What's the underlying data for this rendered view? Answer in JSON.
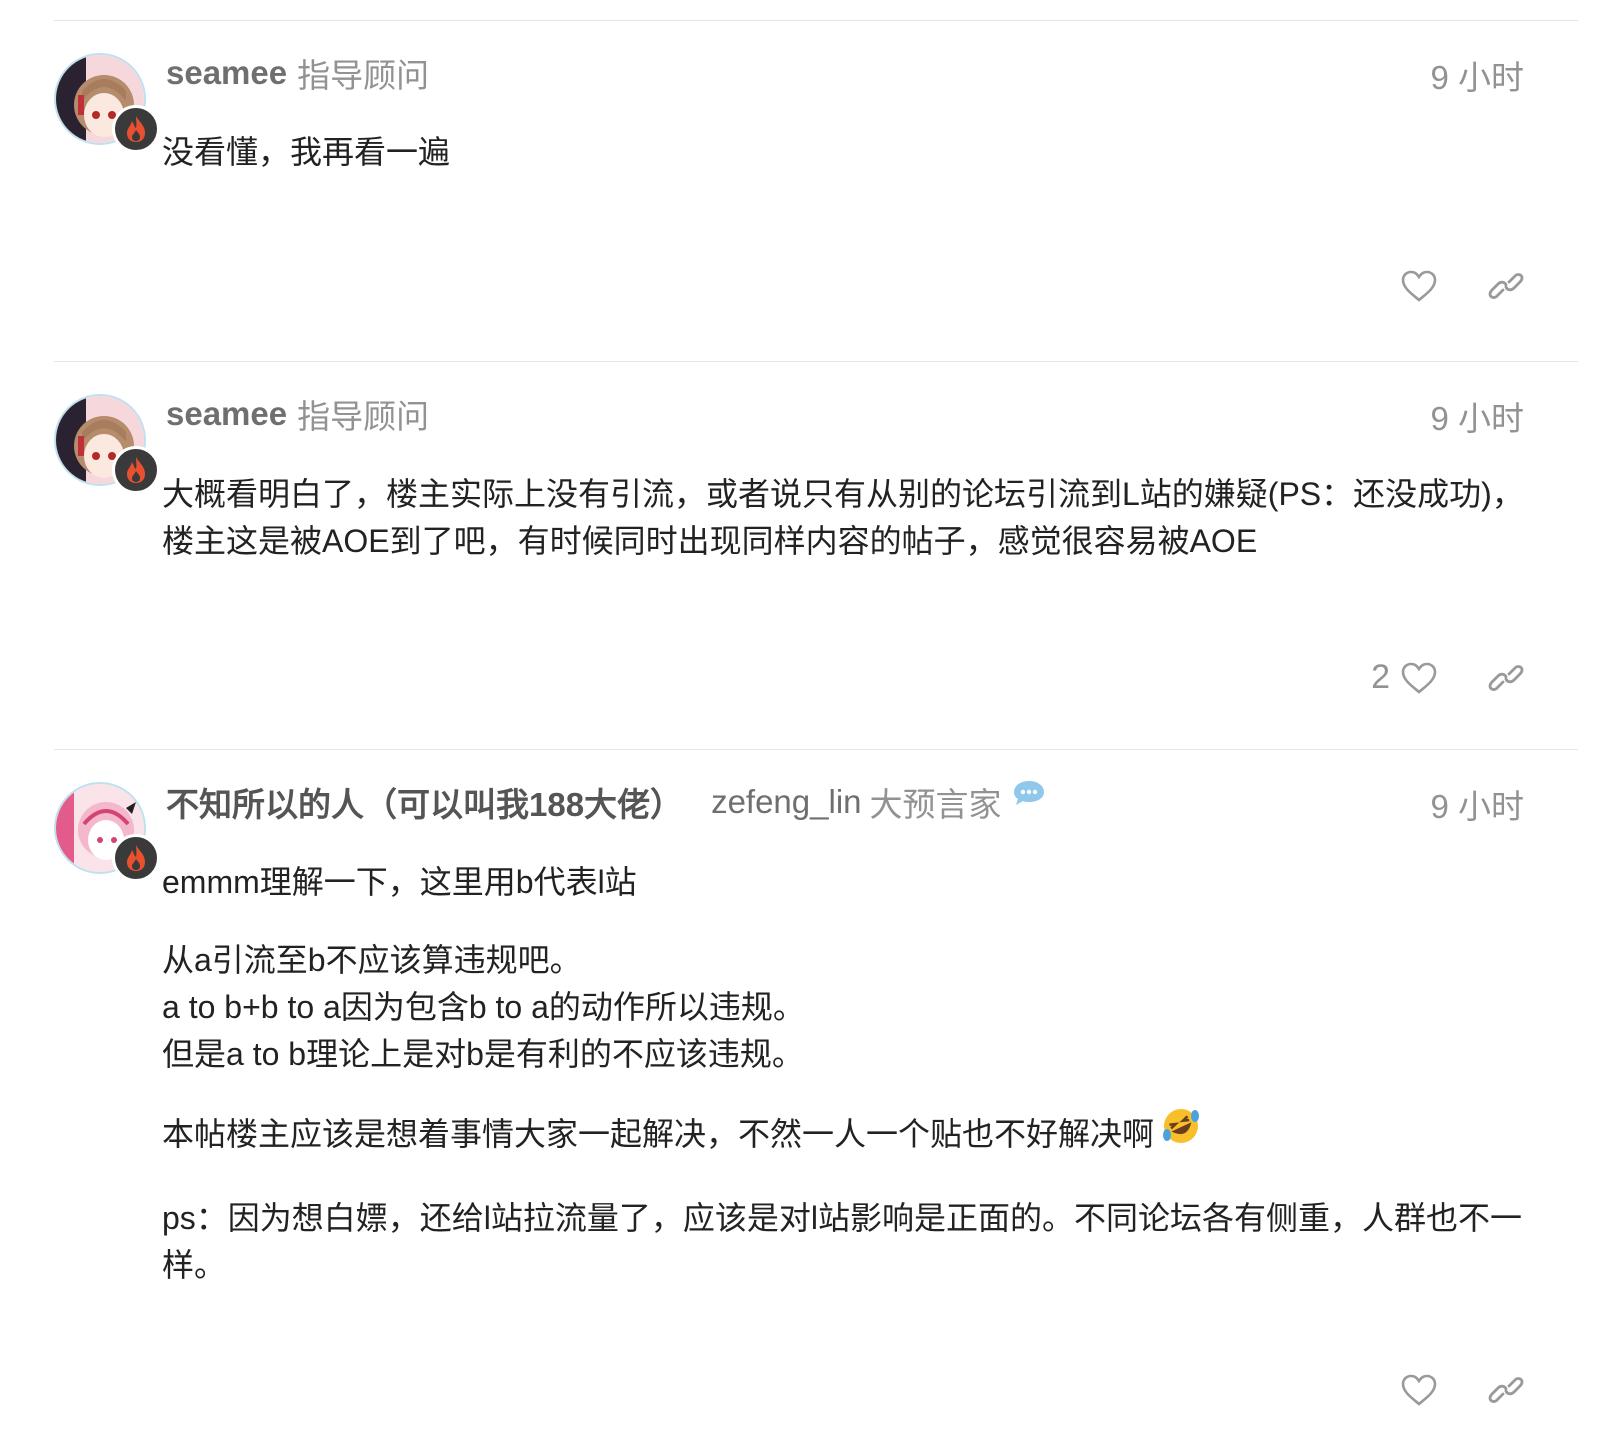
{
  "posts": [
    {
      "username": "seamee",
      "title": "指导顾问",
      "time": "9 小时",
      "paragraphs": [
        "没看懂，我再看一遍"
      ],
      "likes": "",
      "avatar_icon": "anime-girl-avatar",
      "flair_icon": "fire-icon"
    },
    {
      "username": "seamee",
      "title": "指导顾问",
      "time": "9 小时",
      "paragraphs": [
        "大概看明白了，楼主实际上没有引流，或者说只有从别的论坛引流到L站的嫌疑(PS：还没成功)，楼主这是被AOE到了吧，有时候同时出现同样内容的帖子，感觉很容易被AOE"
      ],
      "likes": "2",
      "avatar_icon": "anime-girl-avatar",
      "flair_icon": "fire-icon"
    },
    {
      "full_name": "不知所以的人（可以叫我188大佬）",
      "username": "zefeng_lin",
      "title": "大预言家",
      "time": "9 小时",
      "paragraphs": [
        "emmm理解一下，这里用b代表l站",
        "从a引流至b不应该算违规吧。",
        "a to b+b to a因为包含b to a的动作所以违规。",
        "但是a to b理论上是对b是有利的不应该违规。",
        "本帖楼主应该是想着事情大家一起解决，不然一人一个贴也不好解决啊",
        "ps：因为想白嫖，还给l站拉流量了，应该是对l站影响是正面的。不同论坛各有侧重，人群也不一样。"
      ],
      "likes": "",
      "avatar_icon": "anime-pink-avatar",
      "flair_icon": "fire-icon",
      "status_icon": "chat-bubble-icon",
      "emoji": "rofl-emoji"
    }
  ],
  "icons": {
    "like": "heart-icon",
    "link": "link-icon"
  },
  "colors": {
    "flair_fire": "#e8502f",
    "avatar_ring": "#bfe0ef",
    "muted_text": "#929292"
  }
}
